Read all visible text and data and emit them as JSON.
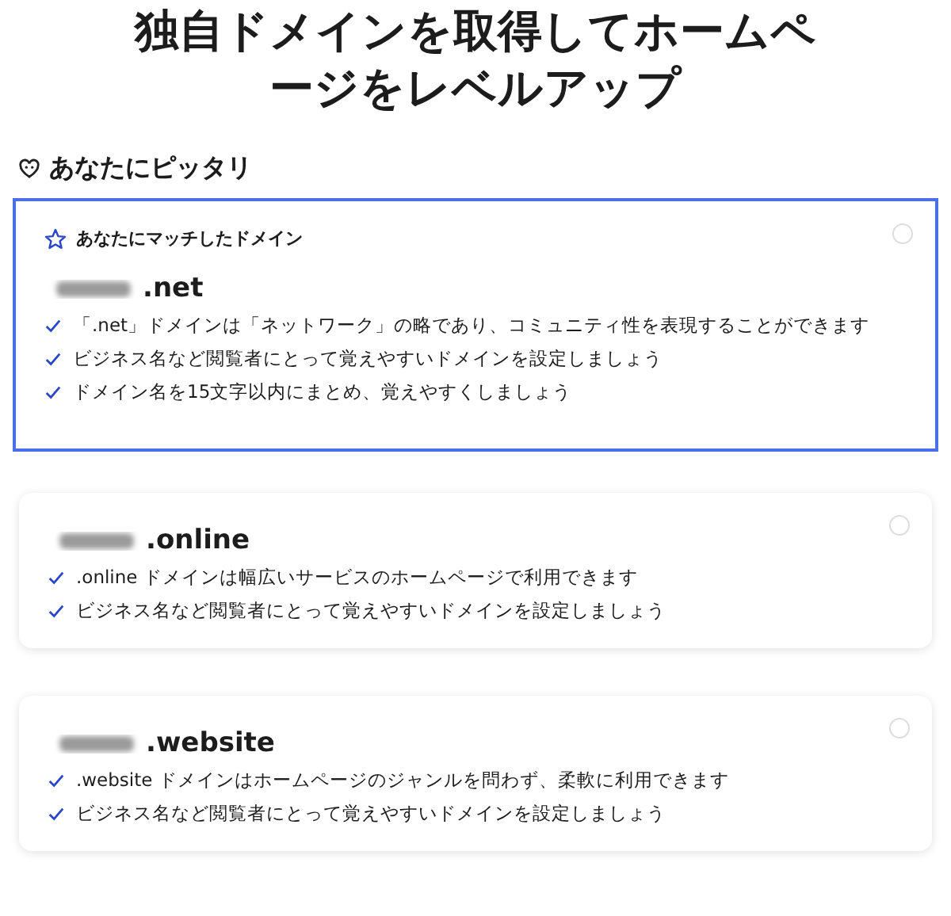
{
  "title": "独自ドメインを取得してホームページをレベルアップ",
  "section": {
    "heading": "あなたにピッタリ"
  },
  "cards": [
    {
      "highlighted": true,
      "selected": false,
      "badge": "あなたにマッチしたドメイン",
      "name_blurred": true,
      "extension": ".net",
      "points": [
        "「.net」ドメインは「ネットワーク」の略であり、コミュニティ性を表現することができます",
        "ビジネス名など閲覧者にとって覚えやすいドメインを設定しましょう",
        "ドメイン名を15文字以内にまとめ、覚えやすくしましょう"
      ]
    },
    {
      "highlighted": false,
      "selected": false,
      "name_blurred": true,
      "extension": ".online",
      "points": [
        ".online ドメインは幅広いサービスのホームページで利用できます",
        "ビジネス名など閲覧者にとって覚えやすいドメインを設定しましょう"
      ]
    },
    {
      "highlighted": false,
      "selected": false,
      "name_blurred": true,
      "extension": ".website",
      "points": [
        ".website ドメインはホームページのジャンルを問わず、柔軟に利用できます",
        "ビジネス名など閲覧者にとって覚えやすいドメインを設定しましょう"
      ]
    }
  ]
}
